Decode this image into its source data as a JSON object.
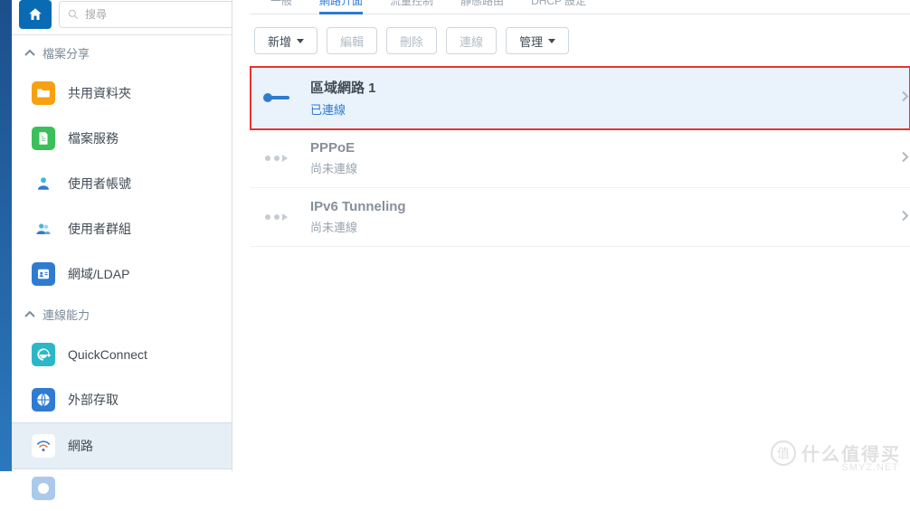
{
  "search": {
    "placeholder": "搜尋"
  },
  "sidebar": {
    "sections": {
      "fileshare": {
        "label": "檔案分享"
      },
      "connect": {
        "label": "連線能力"
      }
    },
    "items": {
      "sharedFolder": "共用資料夾",
      "fileService": "檔案服務",
      "userAccount": "使用者帳號",
      "userGroup": "使用者群組",
      "domainLdap": "網域/LDAP",
      "quickConnect": "QuickConnect",
      "externalAccess": "外部存取",
      "network": "網路"
    }
  },
  "tabs": {
    "general": "一般",
    "interface": "網路介面",
    "traffic": "流量控制",
    "route": "靜態路由",
    "dhcp": "DHCP 設定"
  },
  "toolbar": {
    "add": "新增",
    "edit": "編輯",
    "delete": "刪除",
    "connect": "連線",
    "manage": "管理"
  },
  "connections": [
    {
      "title": "區域網路 1",
      "status": "已連線",
      "connected": true
    },
    {
      "title": "PPPoE",
      "status": "尚未連線",
      "connected": false
    },
    {
      "title": "IPv6 Tunneling",
      "status": "尚未連線",
      "connected": false
    }
  ],
  "watermark": {
    "badge": "值",
    "text": "什么值得买",
    "sub": "SMYZ.NET"
  }
}
